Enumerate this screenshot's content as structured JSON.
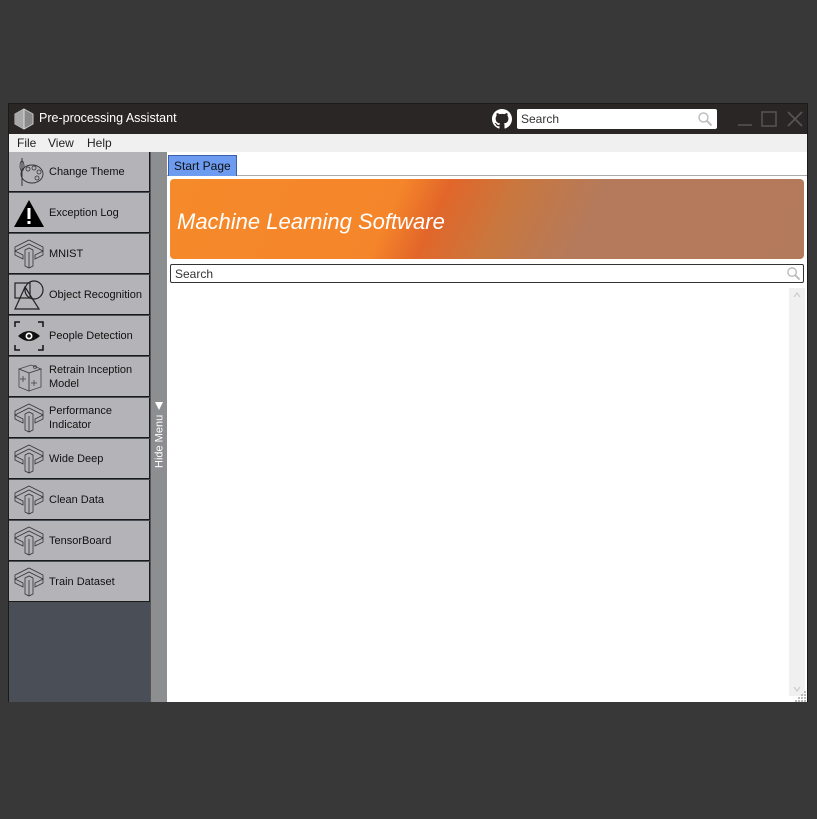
{
  "window": {
    "title": "Pre-processing Assistant",
    "app_icon": "hexagon-cube-icon",
    "github_icon": "github-icon",
    "search_placeholder": "Search",
    "controls": [
      "minimize",
      "maximize",
      "close"
    ]
  },
  "menubar": {
    "items": [
      "File",
      "View",
      "Help"
    ]
  },
  "sidebar": {
    "items": [
      {
        "label": "Change Theme",
        "icon": "palette-icon"
      },
      {
        "label": "Exception Log",
        "icon": "warning-icon"
      },
      {
        "label": "MNIST",
        "icon": "tensorflow-icon"
      },
      {
        "label": "Object Recognition",
        "icon": "shapes-icon"
      },
      {
        "label": "People Detection",
        "icon": "eye-icon"
      },
      {
        "label": "Retrain Inception Model",
        "icon": "cube-icon"
      },
      {
        "label": "Performance Indicator",
        "icon": "tensorflow-icon"
      },
      {
        "label": "Wide Deep",
        "icon": "tensorflow-icon"
      },
      {
        "label": "Clean Data",
        "icon": "tensorflow-icon"
      },
      {
        "label": "TensorBoard",
        "icon": "tensorflow-icon"
      },
      {
        "label": "Train Dataset",
        "icon": "tensorflow-icon"
      }
    ],
    "hide_label": "Hide Menu"
  },
  "main": {
    "tabs": [
      {
        "label": "Start Page",
        "active": true
      }
    ],
    "banner_title": "Machine Learning Software",
    "search_placeholder": "Search"
  },
  "colors": {
    "titlebar": "#2b2626",
    "tab_active": "#6d9bef",
    "banner_orange": "#f58a2a",
    "banner_brown": "#b37a5b",
    "sidebar_item": "#b4b4b8",
    "sidebar_bg": "#4a4e56"
  }
}
